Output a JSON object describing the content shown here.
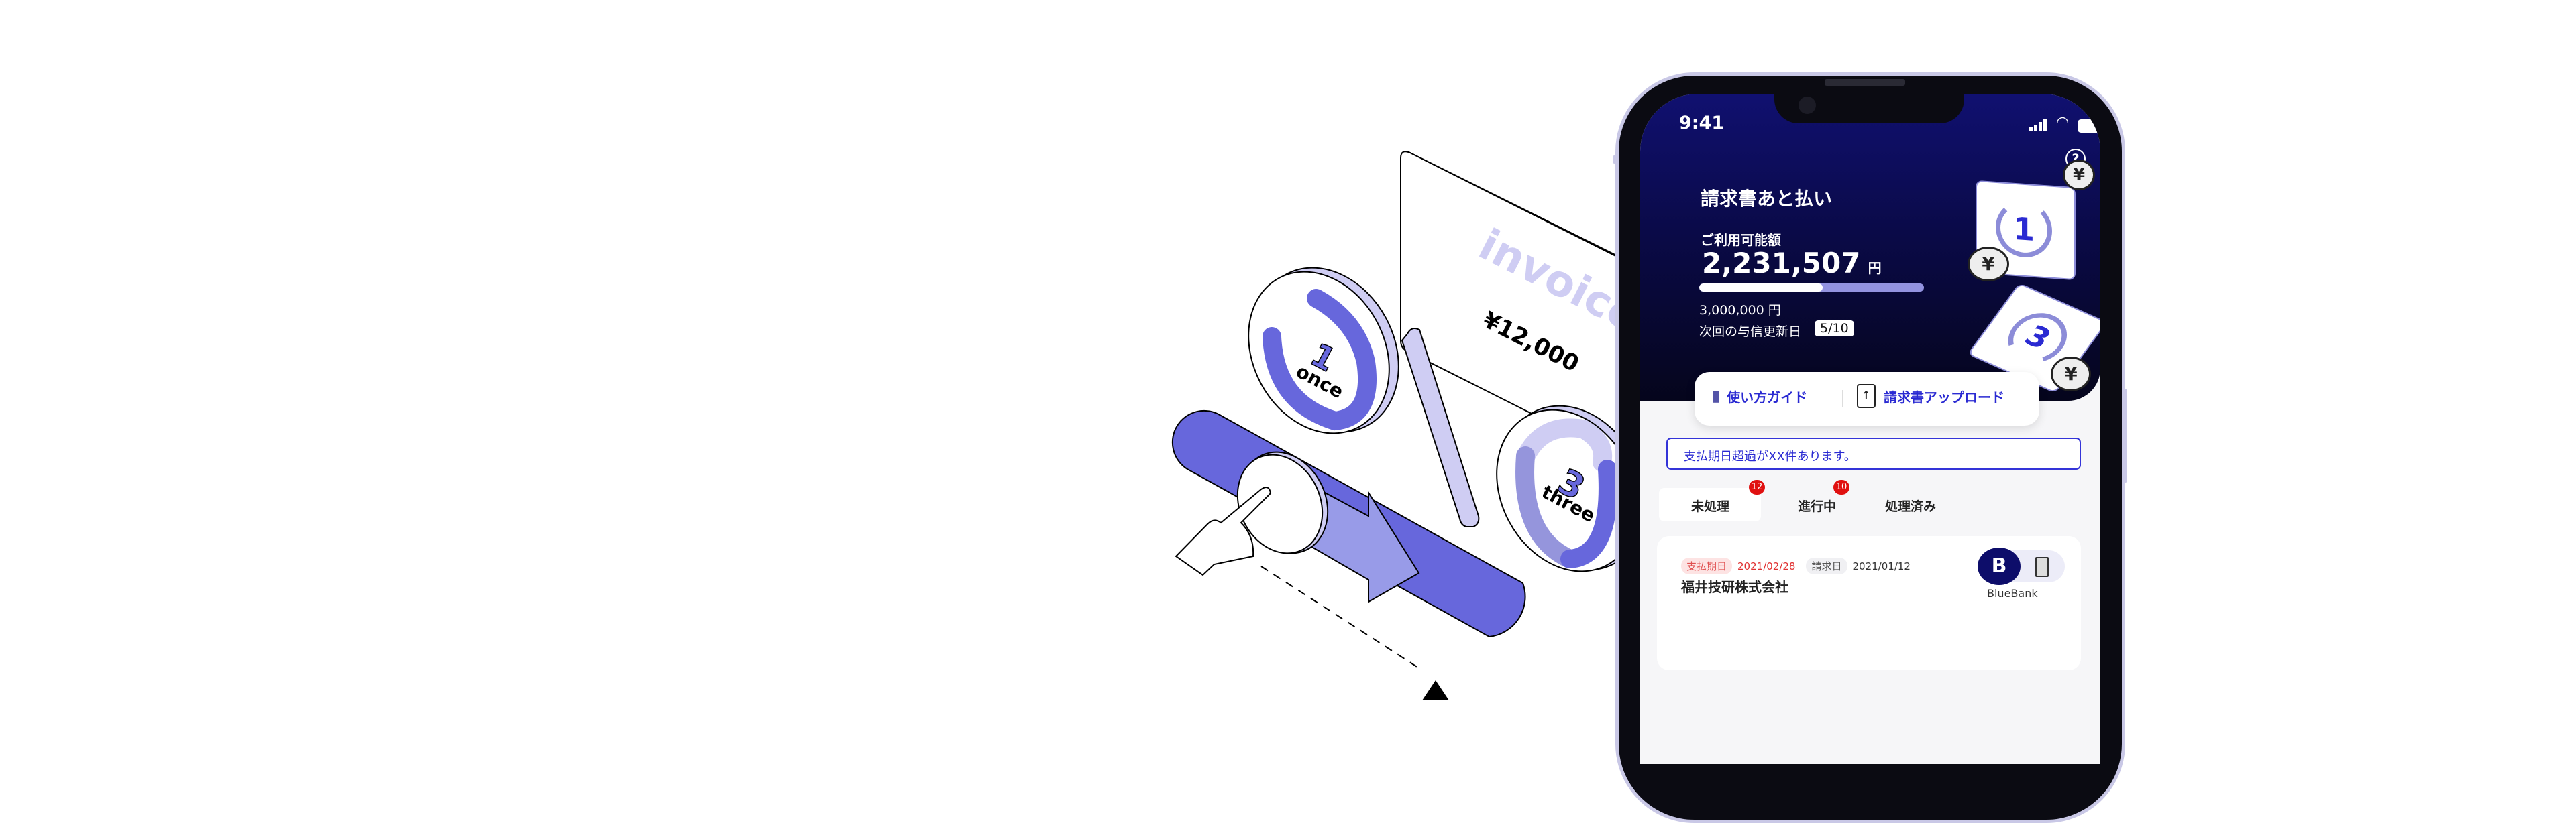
{
  "illustration": {
    "invoice_label": "invoice",
    "invoice_amount": "¥12,000",
    "coin_once_number": "1",
    "coin_once_label": "once",
    "coin_three_number": "3",
    "coin_three_label": "three"
  },
  "status_bar": {
    "time": "9:41"
  },
  "header": {
    "title": "請求書あと払い",
    "available_label": "ご利用可能額",
    "available_amount": "2,231,507",
    "currency": "円",
    "usage_fraction": 0.55,
    "limit_amount": "3,000,000 円",
    "renewal_label": "次回の与信更新日",
    "renewal_date": "5/10",
    "art_card_1": "1",
    "art_card_3": "3",
    "yen": "¥"
  },
  "actions": {
    "guide_label": "使い方ガイド",
    "upload_label": "請求書アップロード"
  },
  "alert": {
    "text": "支払期日超過がXX件あります。"
  },
  "tabs": [
    {
      "label": "未処理",
      "badge": "12",
      "active": true
    },
    {
      "label": "進行中",
      "badge": "10",
      "active": false
    },
    {
      "label": "処理済み",
      "badge": null,
      "active": false
    }
  ],
  "invoices": [
    {
      "due_label": "支払期日",
      "due_date": "2021/02/28",
      "issue_label": "請求日",
      "issue_date": "2021/01/12",
      "company": "福井技研株式会社",
      "bank": "BlueBank"
    }
  ],
  "colors": {
    "accent": "#6767dc",
    "accent_light": "#cfcdf3",
    "navy": "#101070",
    "link_blue": "#2a2ad2",
    "badge_red": "#e01010"
  }
}
